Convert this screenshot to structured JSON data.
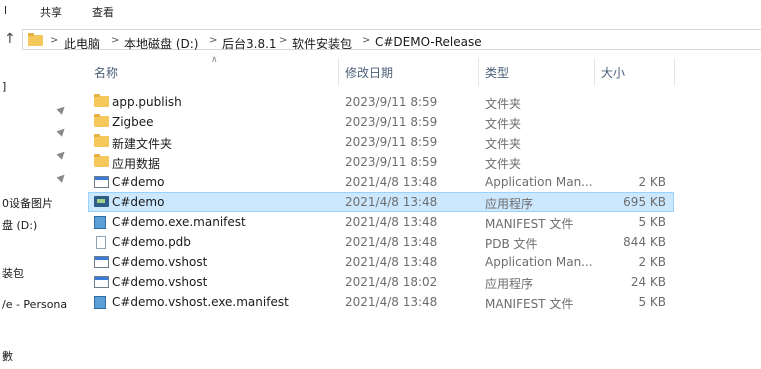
{
  "ribbon": {
    "left_tab": "l",
    "share": "共享",
    "view": "查看"
  },
  "address": {
    "up_glyph": "↑",
    "breadcrumbs": [
      "此电脑",
      "本地磁盘 (D:)",
      "后台3.8.1",
      "软件安装包",
      "C#DEMO-Release"
    ]
  },
  "nav": {
    "items": [
      "]",
      "0设备图片",
      "盘 (D:)",
      "装包",
      "/e - Persona",
      "數"
    ]
  },
  "columns": {
    "name": "名称",
    "date": "修改日期",
    "type": "类型",
    "size": "大小"
  },
  "files": [
    {
      "name": "app.publish",
      "date": "2023/9/11 8:59",
      "type": "文件夹",
      "size": "",
      "icon": "folder-icon"
    },
    {
      "name": "Zigbee",
      "date": "2023/9/11 8:59",
      "type": "文件夹",
      "size": "",
      "icon": "folder-icon"
    },
    {
      "name": "新建文件夹",
      "date": "2023/9/11 8:59",
      "type": "文件夹",
      "size": "",
      "icon": "folder-icon"
    },
    {
      "name": "应用数据",
      "date": "2023/9/11 8:59",
      "type": "文件夹",
      "size": "",
      "icon": "folder-icon"
    },
    {
      "name": "C#demo",
      "date": "2021/4/8 13:48",
      "type": "Application Man...",
      "size": "2 KB",
      "icon": "application-manifest-icon"
    },
    {
      "name": "C#demo",
      "date": "2021/4/8 13:48",
      "type": "应用程序",
      "size": "695 KB",
      "icon": "exe-icon",
      "selected": true
    },
    {
      "name": "C#demo.exe.manifest",
      "date": "2021/4/8 13:48",
      "type": "MANIFEST 文件",
      "size": "5 KB",
      "icon": "manifest-file-icon"
    },
    {
      "name": "C#demo.pdb",
      "date": "2021/4/8 13:48",
      "type": "PDB 文件",
      "size": "844 KB",
      "icon": "document-icon"
    },
    {
      "name": "C#demo.vshost",
      "date": "2021/4/8 13:48",
      "type": "Application Man...",
      "size": "2 KB",
      "icon": "application-manifest-icon"
    },
    {
      "name": "C#demo.vshost",
      "date": "2021/4/8 18:02",
      "type": "应用程序",
      "size": "24 KB",
      "icon": "vshost-exe-icon"
    },
    {
      "name": "C#demo.vshost.exe.manifest",
      "date": "2021/4/8 13:48",
      "type": "MANIFEST 文件",
      "size": "5 KB",
      "icon": "manifest-file-icon"
    }
  ],
  "colors": {
    "selection": "#cce8ff",
    "selection_border": "#99d1ff",
    "folder": "#f5c85b",
    "header_text": "#4c607a"
  }
}
